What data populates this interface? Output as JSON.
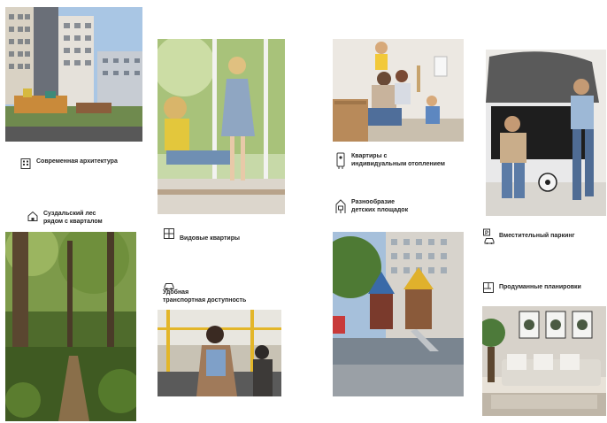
{
  "features": [
    {
      "id": "architecture",
      "icon": "building-icon",
      "label": "Современная архитектура"
    },
    {
      "id": "forest",
      "icon": "forest-house-icon",
      "label": "Суздальский лес\nрядом с кварталом"
    },
    {
      "id": "views",
      "icon": "window-view-icon",
      "label": "Видовые квартиры"
    },
    {
      "id": "transport",
      "icon": "car-icon",
      "label": "Удобная\nтранспортная доступность"
    },
    {
      "id": "heating",
      "icon": "boiler-icon",
      "label": "Квартиры с\nиндивидуальным отоплением"
    },
    {
      "id": "playgrounds",
      "icon": "playground-icon",
      "label": "Разнообразие\nдетских площадок"
    },
    {
      "id": "parking",
      "icon": "parking-icon",
      "label": "Вместительный паркинг"
    },
    {
      "id": "layouts",
      "icon": "floor-plan-icon",
      "label": "Продуманные планировки"
    }
  ],
  "colors": {
    "text": "#222222",
    "sky": "#a9c6e4",
    "foliage": "#5e7a3a",
    "interior": "#e8e2d8"
  }
}
